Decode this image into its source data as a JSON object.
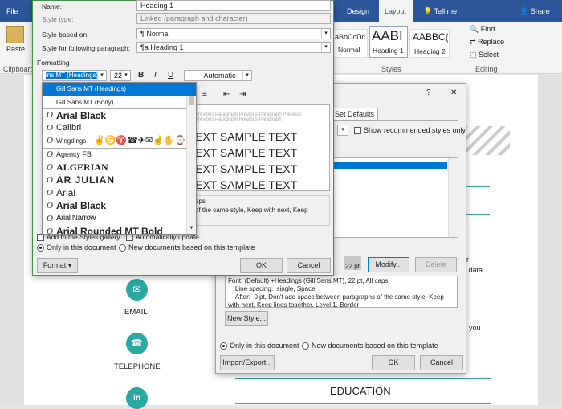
{
  "ribbon": {
    "file_tab": "File",
    "tabs": [
      "Design",
      "Layout"
    ],
    "tell_me": "Tell me",
    "share": "Share",
    "paste": "Paste",
    "clipboard": "Clipboard",
    "styles_group": "Styles",
    "editing_group": "Editing",
    "style_gallery": [
      {
        "preview": "aBbCcDc",
        "name": "Normal"
      },
      {
        "preview": "AABI",
        "name": "Heading 1"
      },
      {
        "preview": "AABBC(",
        "name": "Heading 2"
      }
    ],
    "find": "Find",
    "replace": "Replace",
    "select": "Select"
  },
  "modify_dialog": {
    "name_label": "Name:",
    "name_value": "Heading 1",
    "style_type_label": "Style type:",
    "style_type_value": "Linked (paragraph and character)",
    "based_on_label": "Style based on:",
    "based_on_value": "Normal",
    "following_label": "Style for following paragraph:",
    "following_value": "Heading 1",
    "formatting_label": "Formatting",
    "font_value": "ins MT (Headings)",
    "size_value": "22",
    "bold": "B",
    "italic": "I",
    "underline": "U",
    "color_value": "Automatic",
    "preview_prev": "Previous Paragraph Previous Paragraph Previous",
    "preview_prev2": "Previous Paragraph Previous Paragraph",
    "sample_lines": [
      "EXT SAMPLE TEXT",
      "EXT SAMPLE TEXT",
      "EXT SAMPLE TEXT",
      "EXT SAMPLE TEXT"
    ],
    "desc_line1": "aps",
    "desc_line2": "of the same style, Keep with next, Keep",
    "add_to_gallery": "Add to the Styles gallery",
    "auto_update": "Automatically update",
    "only_doc": "Only in this document",
    "new_docs": "New documents based on this template",
    "format_btn": "Format",
    "ok": "OK",
    "cancel": "Cancel"
  },
  "font_list": [
    {
      "name": "Gill Sans MT (Headings)",
      "selected": true
    },
    {
      "name": "Gill Sans MT (Body)"
    },
    {
      "name": "Arial Black"
    },
    {
      "name": "Calibri"
    },
    {
      "name": "Wingdings"
    },
    {
      "name": "Agency FB"
    },
    {
      "name": "ALGERIAN"
    },
    {
      "name": "AR JULIAN"
    },
    {
      "name": "Arial"
    },
    {
      "name": "Arial Black"
    },
    {
      "name": "Arial Narrow"
    },
    {
      "name": "Arial Rounded MT Bold"
    }
  ],
  "manage_dialog": {
    "help": "?",
    "close": "✕",
    "set_defaults_tab": "Set Defaults",
    "show_recommended": "Show recommended styles only",
    "size_preview": "22 pt",
    "modify_btn": "Modify...",
    "delete_btn": "Delete",
    "desc": "Font: (Default) +Headings (Gill Sans MT), 22 pt, All caps\n    Line spacing:  single, Space\n    After:  0 pt, Don't add space between paragraphs of the same style, Keep with next, Keep lines together, Level 1, Border:",
    "new_style_btn": "New Style...",
    "only_doc": "Only in this document",
    "new_docs": "New documents based on this template",
    "import_export": "Import/Export...",
    "ok": "OK",
    "cancel": "Cancel"
  },
  "document": {
    "email": "EMAIL",
    "telephone": "TELEPHONE",
    "education": "EDUCATION",
    "side_text1": "ar",
    "side_text2": "e data",
    "side_text3": "you"
  }
}
